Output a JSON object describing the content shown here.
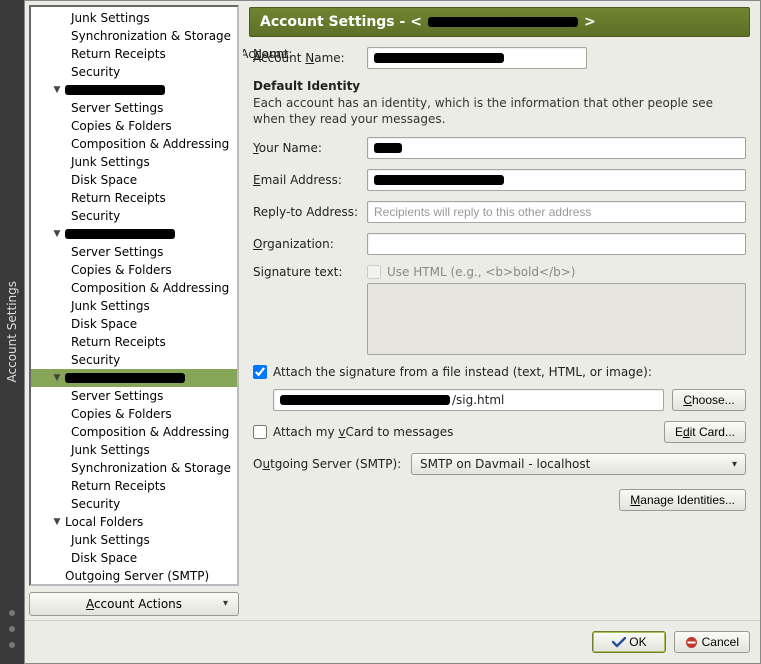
{
  "window": {
    "title": "Account Settings"
  },
  "header": {
    "prefix": "Account Settings - <",
    "account_name_redacted": "████████████████",
    "suffix": ">"
  },
  "sidebar": {
    "accounts": [
      {
        "name_redacted": true,
        "children": [
          "Junk Settings",
          "Synchronization & Storage",
          "Return Receipts",
          "Security"
        ],
        "partial_top": true
      },
      {
        "name_redacted": true,
        "children": [
          "Server Settings",
          "Copies & Folders",
          "Composition & Addressing",
          "Junk Settings",
          "Disk Space",
          "Return Receipts",
          "Security"
        ]
      },
      {
        "name_redacted": true,
        "children": [
          "Server Settings",
          "Copies & Folders",
          "Composition & Addressing",
          "Junk Settings",
          "Disk Space",
          "Return Receipts",
          "Security"
        ]
      },
      {
        "name_redacted": true,
        "selected": true,
        "children": [
          "Server Settings",
          "Copies & Folders",
          "Composition & Addressing",
          "Junk Settings",
          "Synchronization & Storage",
          "Return Receipts",
          "Security"
        ]
      },
      {
        "name": "Local Folders",
        "children": [
          "Junk Settings",
          "Disk Space"
        ]
      }
    ],
    "bottom_item": "Outgoing Server (SMTP)",
    "account_actions": "Account Actions"
  },
  "form": {
    "account_name_label": "Account Name:",
    "account_name_redacted": "██████████████████",
    "default_identity": "Default Identity",
    "identity_hint": "Each account has an identity, which is the information that other people see when they read your messages.",
    "your_name_label": "Your Name:",
    "your_name_redacted": "████",
    "email_label": "Email Address:",
    "email_redacted": "███████████████████",
    "reply_label": "Reply-to Address:",
    "reply_placeholder": "Recipients will reply to this other address",
    "org_label": "Organization:",
    "sig_label": "Signature text:",
    "use_html_label": "Use HTML (e.g., <b>bold</b>)",
    "attach_sig_label": "Attach the signature from a file instead (text, HTML, or image):",
    "sig_path_prefix_redacted": "██████████████████████████",
    "sig_path_suffix": "/sig.html",
    "choose": "Choose...",
    "attach_vcard": "Attach my vCard to messages",
    "edit_card": "Edit Card...",
    "smtp_label": "Outgoing Server (SMTP):",
    "smtp_value": "SMTP on Davmail - localhost",
    "manage_identities": "Manage Identities..."
  },
  "footer": {
    "ok": "OK",
    "cancel": "Cancel"
  }
}
